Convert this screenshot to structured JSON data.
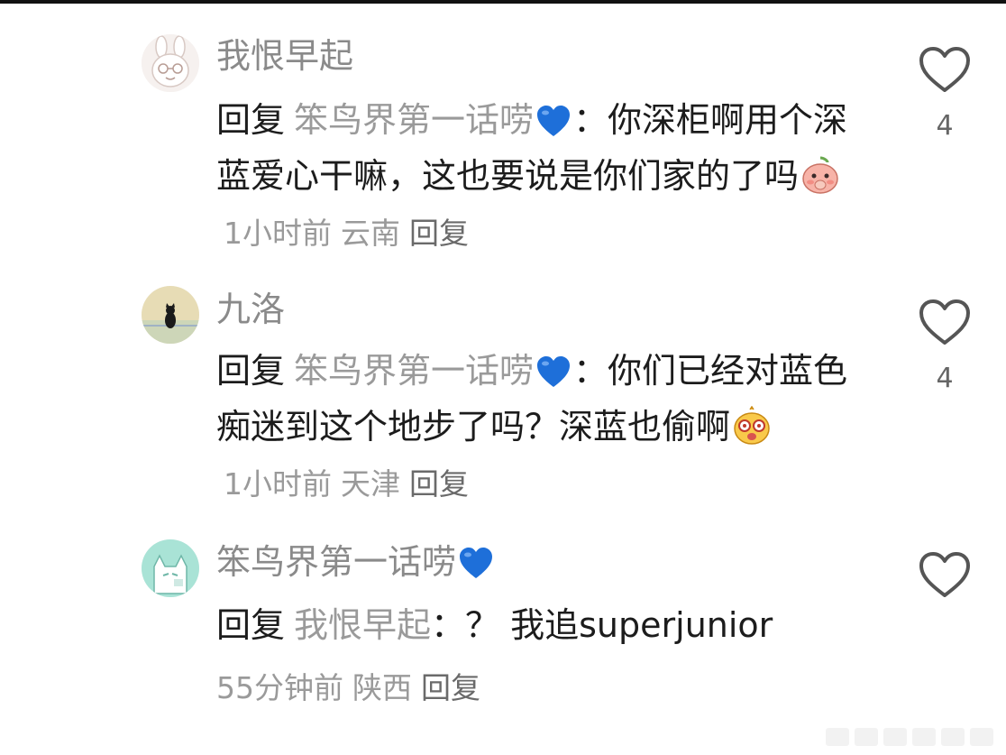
{
  "comments": [
    {
      "username": "我恨早起",
      "reply_prefix": "回复",
      "reply_target": "笨鸟界第一话唠",
      "reply_target_emoji": "blue-heart",
      "colon": "：",
      "text": "你深柜啊用个深蓝爱心干嘛，这也要说是你们家的了吗",
      "trailing_emoji": "shy-peach-emoji",
      "time": "1小时前",
      "location": "云南",
      "reply_label": "回复",
      "likes": "4",
      "avatar_icon": "bunny-avatar"
    },
    {
      "username": "九洛",
      "reply_prefix": "回复",
      "reply_target": "笨鸟界第一话唠",
      "reply_target_emoji": "blue-heart",
      "colon": "：",
      "text": "你们已经对蓝色痴迷到这个地步了吗？深蓝也偷啊",
      "trailing_emoji": "dizzy-face-emoji",
      "time": "1小时前",
      "location": "天津",
      "reply_label": "回复",
      "likes": "4",
      "avatar_icon": "black-cat-avatar"
    },
    {
      "username": "笨鸟界第一话唠",
      "username_emoji": "blue-heart",
      "reply_prefix": "回复",
      "reply_target": "我恨早起",
      "colon": "：",
      "text": "？ 我追superjunior",
      "time": "55分钟前",
      "location": "陕西",
      "reply_label": "回复",
      "likes": "",
      "avatar_icon": "cartoon-cat-avatar"
    }
  ],
  "colors": {
    "username": "#8a8a8a",
    "body": "#1c1c1c",
    "reply_target": "#9a9a9a",
    "blue_heart": "#1e6fd9"
  },
  "icons": {
    "like": "heart-outline-icon"
  }
}
